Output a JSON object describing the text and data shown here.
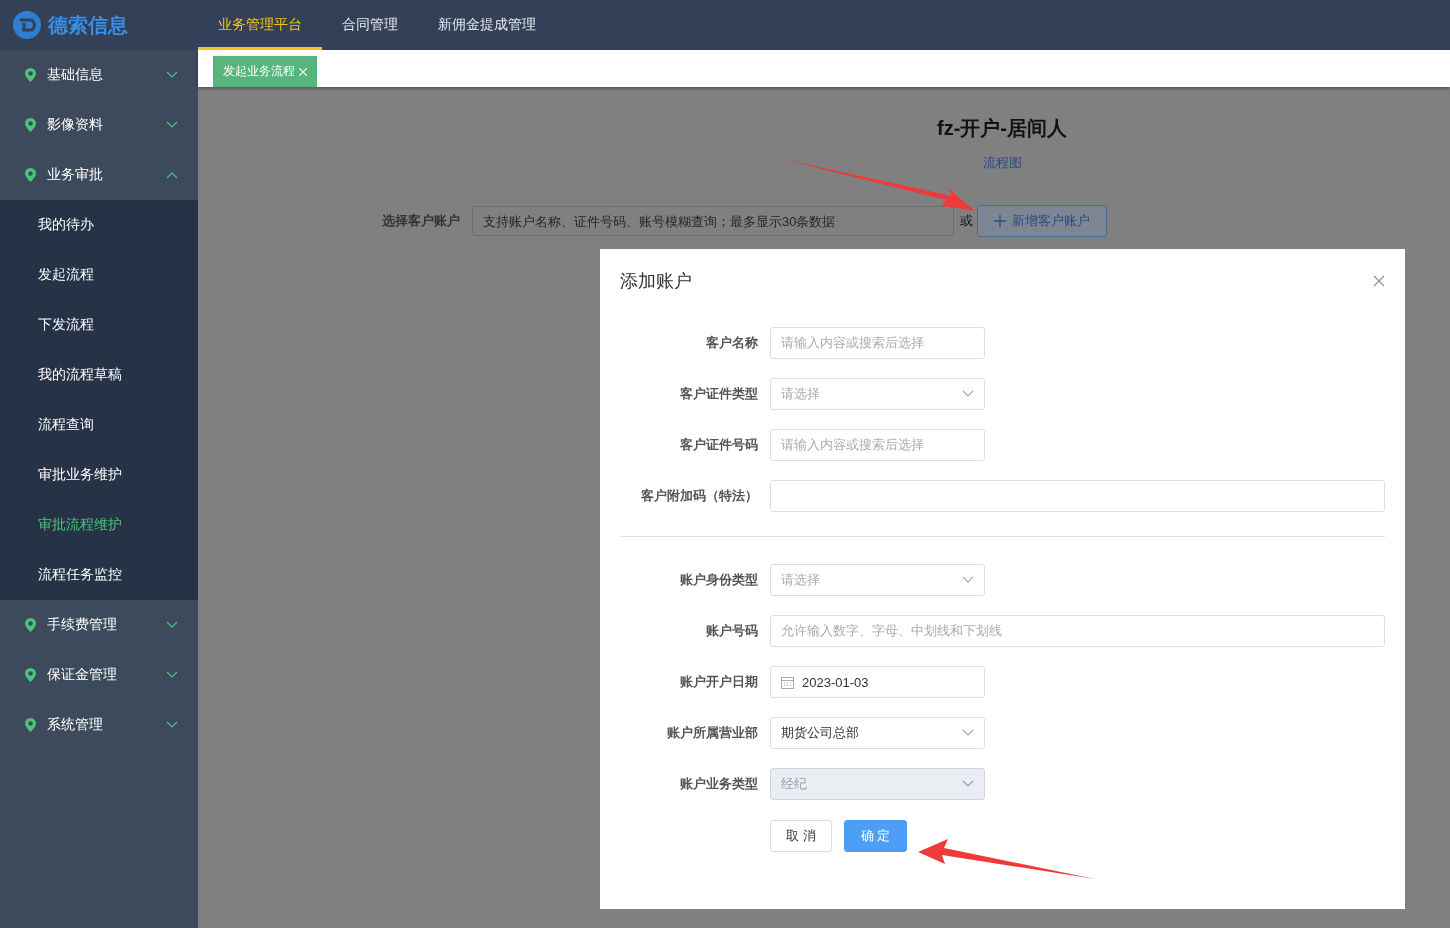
{
  "logo": {
    "text": "德索信息"
  },
  "top_nav": [
    {
      "label": "业务管理平台",
      "selected": true
    },
    {
      "label": "合同管理",
      "selected": false
    },
    {
      "label": "新佣金提成管理",
      "selected": false
    }
  ],
  "sidebar": {
    "items": [
      {
        "label": "基础信息",
        "expanded": false
      },
      {
        "label": "影像资料",
        "expanded": false
      },
      {
        "label": "业务审批",
        "expanded": true,
        "children": [
          {
            "label": "我的待办",
            "selected": false
          },
          {
            "label": "发起流程",
            "selected": false
          },
          {
            "label": "下发流程",
            "selected": false
          },
          {
            "label": "我的流程草稿",
            "selected": false
          },
          {
            "label": "流程查询",
            "selected": false
          },
          {
            "label": "审批业务维护",
            "selected": false
          },
          {
            "label": "审批流程维护",
            "selected": true
          },
          {
            "label": "流程任务监控",
            "selected": false
          }
        ]
      },
      {
        "label": "手续费管理",
        "expanded": false
      },
      {
        "label": "保证金管理",
        "expanded": false
      },
      {
        "label": "系统管理",
        "expanded": false
      }
    ]
  },
  "page_tabs": [
    {
      "label": "发起业务流程",
      "selected": true
    }
  ],
  "page": {
    "title": "fz-开户-居间人",
    "link": "流程图",
    "account_label": "选择客户账户",
    "account_placeholder": "支持账户名称、证件号码、账号模糊查询；最多显示30条数据",
    "or_text": "或",
    "add_button": "新增客户账户"
  },
  "dialog": {
    "title": "添加账户",
    "sections": [
      [
        {
          "kind": "text",
          "label": "客户名称",
          "placeholder": "请输入内容或搜索后选择",
          "disabled": false
        },
        {
          "kind": "select",
          "label": "客户证件类型",
          "placeholder": "请选择",
          "disabled": false
        },
        {
          "kind": "text",
          "label": "客户证件号码",
          "placeholder": "请输入内容或搜索后选择",
          "disabled": false
        },
        {
          "kind": "wide",
          "label": "客户附加码（特法）",
          "disabled": false
        }
      ],
      [
        {
          "kind": "select",
          "label": "账户身份类型",
          "placeholder": "请选择",
          "disabled": false
        },
        {
          "kind": "wide",
          "label": "账户号码",
          "placeholder": "允许输入数字、字母、中划线和下划线",
          "disabled": false
        },
        {
          "kind": "date",
          "label": "账户开户日期",
          "value": "2023-01-03",
          "disabled": false
        },
        {
          "kind": "select",
          "label": "账户所属营业部",
          "value": "期货公司总部",
          "disabled": false
        },
        {
          "kind": "select",
          "label": "账户业务类型",
          "placeholder": "经纪",
          "disabled": true
        }
      ]
    ],
    "cancel": "取 消",
    "confirm": "确 定"
  }
}
